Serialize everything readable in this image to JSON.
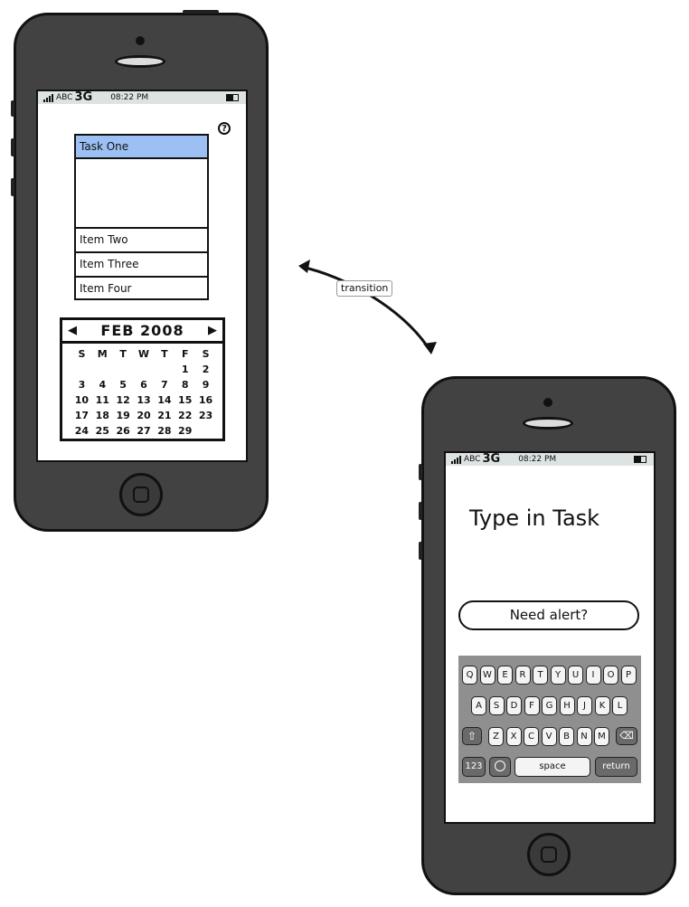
{
  "left_phone": {
    "status": {
      "carrier": "ABC",
      "network": "3G",
      "time": "08:22 PM"
    },
    "help_icon": "?",
    "list": {
      "selected": "Task One",
      "items": [
        "Item Two",
        "Item Three",
        "Item Four"
      ]
    },
    "calendar": {
      "prev": "◀",
      "next": "▶",
      "month": "FEB 2008",
      "weekdays": [
        "S",
        "M",
        "T",
        "W",
        "T",
        "F",
        "S"
      ],
      "weeks": [
        [
          "",
          "",
          "",
          "",
          "",
          "1",
          "2"
        ],
        [
          "3",
          "4",
          "5",
          "6",
          "7",
          "8",
          "9"
        ],
        [
          "10",
          "11",
          "12",
          "13",
          "14",
          "15",
          "16"
        ],
        [
          "17",
          "18",
          "19",
          "20",
          "21",
          "22",
          "23"
        ],
        [
          "24",
          "25",
          "26",
          "27",
          "28",
          "29",
          ""
        ]
      ]
    }
  },
  "connector": {
    "label": "transition"
  },
  "right_phone": {
    "status": {
      "carrier": "ABC",
      "network": "3G",
      "time": "08:22 PM"
    },
    "title": "Type in Task",
    "alert_button": "Need alert?",
    "keyboard": {
      "row1": [
        "Q",
        "W",
        "E",
        "R",
        "T",
        "Y",
        "U",
        "I",
        "O",
        "P"
      ],
      "row2": [
        "A",
        "S",
        "D",
        "F",
        "G",
        "H",
        "J",
        "K",
        "L"
      ],
      "row3": [
        "Z",
        "X",
        "C",
        "V",
        "B",
        "N",
        "M"
      ],
      "shift": "⇧",
      "backspace": "⌫",
      "numbers": "123",
      "globe": "🌐",
      "space": "space",
      "return": "return"
    }
  }
}
